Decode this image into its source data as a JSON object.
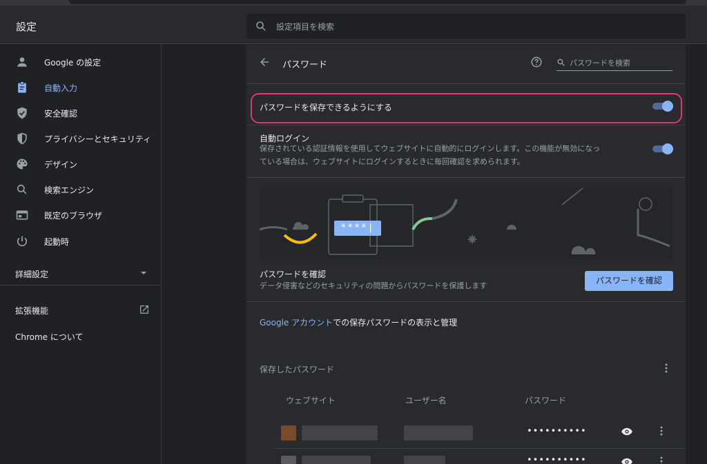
{
  "header": {
    "title": "設定",
    "search_placeholder": "設定項目を検索"
  },
  "sidebar": {
    "items": [
      {
        "label": "Google の設定",
        "icon": "person-icon"
      },
      {
        "label": "自動入力",
        "icon": "clipboard-icon",
        "active": true
      },
      {
        "label": "安全確認",
        "icon": "shield-check-icon"
      },
      {
        "label": "プライバシーとセキュリティ",
        "icon": "shield-icon"
      },
      {
        "label": "デザイン",
        "icon": "palette-icon"
      },
      {
        "label": "検索エンジン",
        "icon": "search-icon"
      },
      {
        "label": "既定のブラウザ",
        "icon": "browser-window-icon"
      },
      {
        "label": "起動時",
        "icon": "power-icon"
      }
    ],
    "advanced_label": "詳細設定",
    "extensions_label": "拡張機能",
    "about_label": "Chrome について"
  },
  "passwords": {
    "title": "パスワード",
    "search_placeholder": "パスワードを検索",
    "offer_save_label": "パスワードを保存できるようにする",
    "offer_save_on": true,
    "auto_signin_label": "自動ログイン",
    "auto_signin_desc_1": "保存されている認証情報を使用してウェブサイトに自動的にログインします。この機能が無効になっ",
    "auto_signin_desc_2": "ている場合は、ウェブサイトにログインするときに毎回確認を求められます。",
    "auto_signin_on": true,
    "banner_password_mask": "****|",
    "check_title": "パスワードを確認",
    "check_desc": "データ侵害などのセキュリティの問題からパスワードを保護します",
    "check_button": "パスワードを確認",
    "account_link": "Google アカウント",
    "account_text": "での保存パスワードの表示と管理",
    "saved_title": "保存したパスワード",
    "columns": [
      "ウェブサイト",
      "ユーザー名",
      "パスワード"
    ],
    "rows": [
      {
        "password": "••••••••••"
      },
      {
        "password": "••••••••••"
      }
    ]
  },
  "colors": {
    "accent": "#8ab4f8",
    "highlight": "#e2386e",
    "background": "#202124",
    "card": "#292a2d"
  }
}
